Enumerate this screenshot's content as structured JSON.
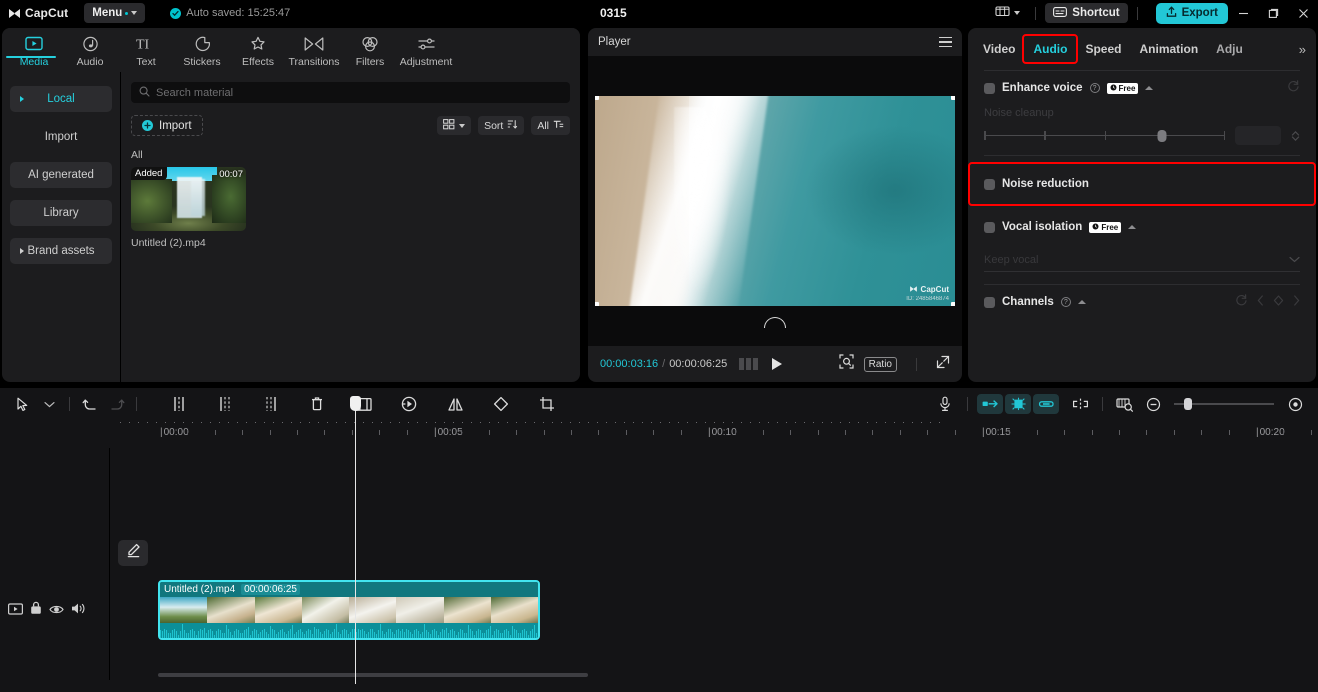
{
  "app": {
    "brand": "CapCut",
    "project_title": "0315"
  },
  "titlebar": {
    "menu_label": "Menu",
    "autosave_text": "Auto saved: 15:25:47",
    "shortcut_label": "Shortcut",
    "export_label": "Export",
    "icons": {
      "grid": "grid-view-icon",
      "minimize": "–",
      "maximize": "❐",
      "close": "✕"
    }
  },
  "nav_tabs": [
    {
      "label": "Media",
      "icon": "media-icon",
      "active": true
    },
    {
      "label": "Audio",
      "icon": "audio-note-icon",
      "active": false
    },
    {
      "label": "Text",
      "icon": "text-icon",
      "active": false
    },
    {
      "label": "Stickers",
      "icon": "stickers-icon",
      "active": false
    },
    {
      "label": "Effects",
      "icon": "effects-sparkle-icon",
      "active": false
    },
    {
      "label": "Transitions",
      "icon": "transitions-icon",
      "active": false
    },
    {
      "label": "Filters",
      "icon": "filters-icon",
      "active": false
    },
    {
      "label": "Adjustment",
      "icon": "adjustment-sliders-icon",
      "active": false
    }
  ],
  "sidebar": {
    "items": [
      {
        "label": "Local",
        "selected": true,
        "expandable": true
      },
      {
        "label": "Import",
        "selected": false,
        "expandable": false
      },
      {
        "label": "AI generated",
        "selected": false,
        "expandable": false
      },
      {
        "label": "Library",
        "selected": false,
        "expandable": false
      },
      {
        "label": "Brand assets",
        "selected": false,
        "expandable": true
      }
    ]
  },
  "media": {
    "search_placeholder": "Search material",
    "import_label": "Import",
    "view_chip": "grid-view-chip",
    "sort_label": "Sort",
    "filter_label": "All",
    "group_label": "All",
    "items": [
      {
        "badge": "Added",
        "duration": "00:07",
        "name": "Untitled (2).mp4"
      }
    ]
  },
  "player": {
    "title": "Player",
    "current_time": "00:00:03:16",
    "total_time": "00:00:06:25",
    "separator": "/",
    "ratio_label": "Ratio",
    "watermark_brand": "CapCut",
    "watermark_id": "ID: 2485846874"
  },
  "right_panel": {
    "tabs": [
      {
        "label": "Video",
        "active": false,
        "highlighted": false
      },
      {
        "label": "Audio",
        "active": true,
        "highlighted": true
      },
      {
        "label": "Speed",
        "active": false,
        "highlighted": false
      },
      {
        "label": "Animation",
        "active": false,
        "highlighted": false
      },
      {
        "label": "Adju",
        "active": false,
        "highlighted": false
      }
    ],
    "more_label": "»",
    "sections": [
      {
        "title": "Enhance voice",
        "has_info": true,
        "badge": "Free",
        "enabled": false,
        "sub_label": "Noise cleanup",
        "slider_value": "",
        "highlighted": false
      },
      {
        "title": "Noise reduction",
        "has_info": false,
        "badge": "",
        "enabled": false,
        "highlighted": true
      },
      {
        "title": "Vocal isolation",
        "has_info": false,
        "badge": "Free",
        "enabled": false,
        "select_value": "Keep vocal",
        "highlighted": false
      },
      {
        "title": "Channels",
        "has_info": true,
        "badge": "",
        "enabled": false,
        "highlighted": false
      }
    ]
  },
  "timeline": {
    "toolbar_icons": [
      "select-cursor-icon",
      "cursor-dropdown-icon",
      "undo-icon",
      "redo-icon",
      "split-icon",
      "trim-left-icon",
      "trim-right-icon",
      "delete-icon",
      "crop-frame-icon",
      "speed-icon",
      "mirror-icon",
      "rotate-icon",
      "crop-icon"
    ],
    "right_icons": [
      "microphone-icon",
      "auto-keyframe-icon",
      "magnet-snap-icon",
      "link-icon",
      "split-marker-icon",
      "preview-scale-icon",
      "zoom-out-icon",
      "zoom-in-icon"
    ],
    "ruler_labels": [
      "00:00",
      "00:05",
      "00:10",
      "00:15",
      "00:20"
    ],
    "track_controls": [
      "video-track-icon",
      "lock-icon",
      "eye-visibility-icon",
      "speaker-volume-icon"
    ],
    "edit_button_icon": "pencil-edit-icon",
    "clip": {
      "name": "Untitled (2).mp4",
      "duration": "00:00:06:25"
    }
  },
  "colors": {
    "accent": "#22c7d6",
    "highlight": "#ff0000",
    "panel_bg": "#1c1c1e",
    "clip_fill": "#0f6d74",
    "clip_border": "#42e4ef"
  }
}
